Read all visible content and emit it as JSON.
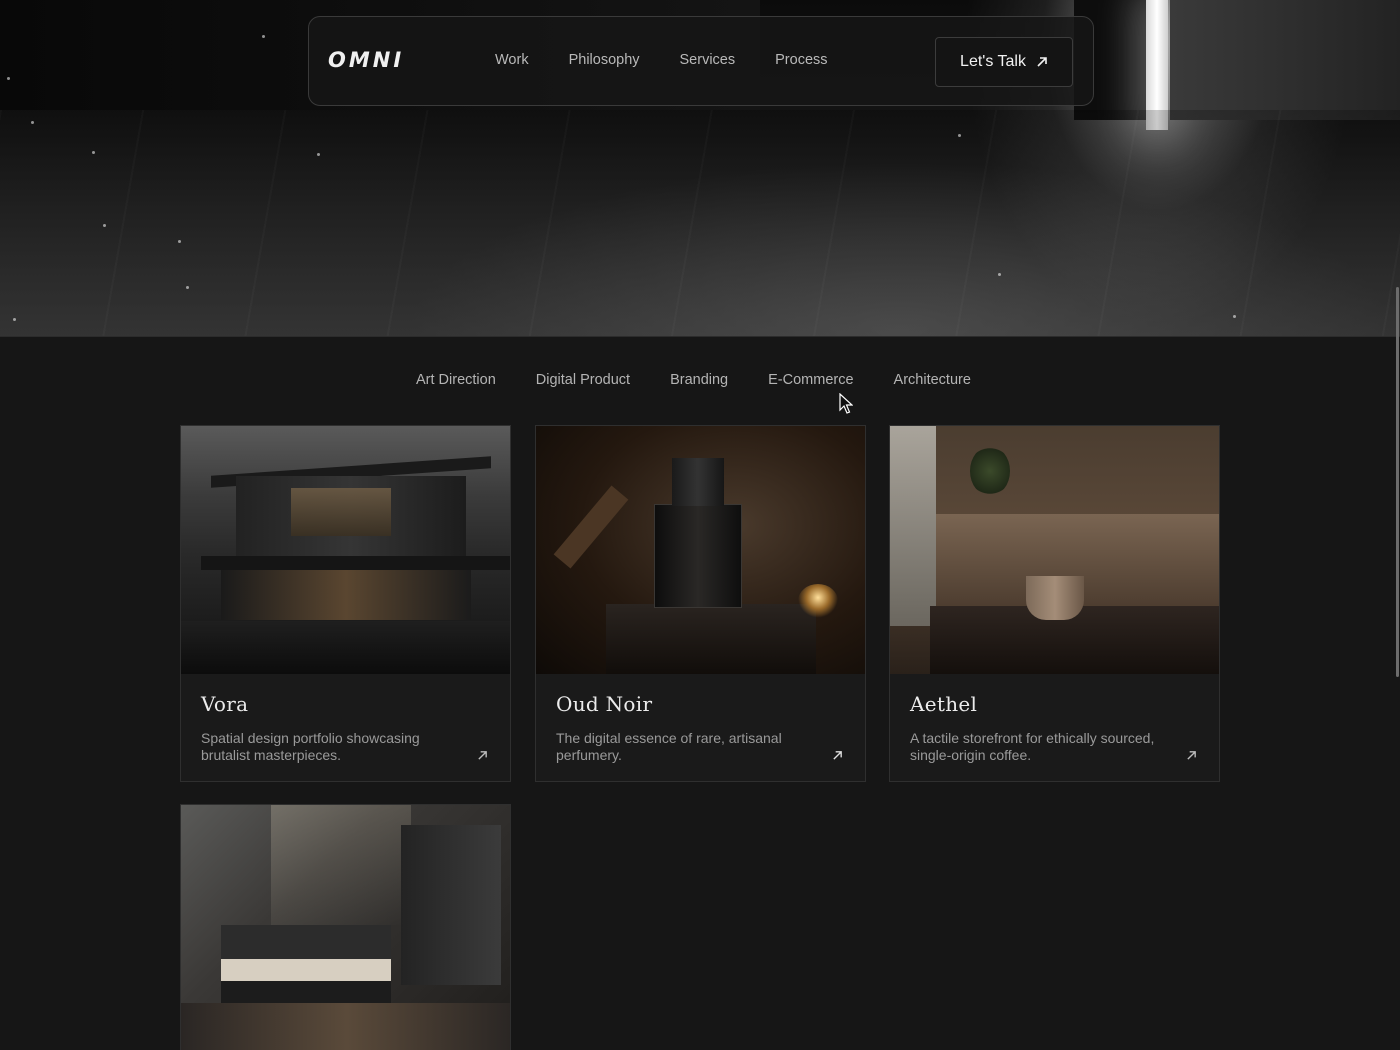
{
  "nav": {
    "logo": "OMNI",
    "links": [
      "Work",
      "Philosophy",
      "Services",
      "Process"
    ],
    "cta_label": "Let's Talk",
    "cta_icon": "arrow-up-right-icon"
  },
  "filters": [
    "Art Direction",
    "Digital Product",
    "Branding",
    "E-Commerce",
    "Architecture"
  ],
  "projects": [
    {
      "title": "Vora",
      "description": "Spatial design portfolio showcasing brutalist masterpieces.",
      "icon": "arrow-up-right-icon"
    },
    {
      "title": "Oud Noir",
      "description": "The digital essence of rare, artisanal perfumery.",
      "icon": "arrow-up-right-icon"
    },
    {
      "title": "Aethel",
      "description": "A tactile storefront for ethically sourced, single-origin coffee.",
      "icon": "arrow-up-right-icon"
    },
    {
      "title": "",
      "description": "",
      "icon": ""
    }
  ],
  "colors": {
    "background": "#161616",
    "card": "#1a1a1a",
    "border": "#2f2f2f",
    "text": "#ececec",
    "muted": "#9a9a9a"
  }
}
